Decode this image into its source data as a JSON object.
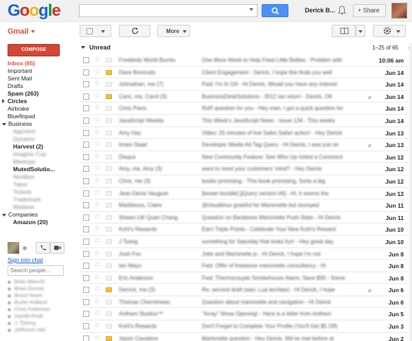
{
  "topbar": {
    "logo": [
      "G",
      "o",
      "o",
      "g",
      "l",
      "e"
    ],
    "logo_colors": [
      "#1a61d7",
      "#d62d20",
      "#f2b50f",
      "#1a61d7",
      "#009925",
      "#d62d20"
    ],
    "search_placeholder": "",
    "user_name": "Derick B...",
    "share_label": "+ Share"
  },
  "toolbar": {
    "app_label": "Gmail",
    "more_label": "More"
  },
  "nav": {
    "compose_label": "COMPOSE",
    "items": [
      {
        "label": "Inbox (65)",
        "style": "active"
      },
      {
        "label": "Important",
        "style": ""
      },
      {
        "label": "Sent Mail",
        "style": ""
      },
      {
        "label": "Drafts",
        "style": ""
      },
      {
        "label": "Spam (263)",
        "style": "bold"
      },
      {
        "label": "Circles",
        "style": "bold-collapsed"
      },
      {
        "label": "Airbrake",
        "style": ""
      },
      {
        "label": "Bluefinpad",
        "style": ""
      },
      {
        "label": "Business",
        "style": "expanded"
      },
      {
        "label": "AppVerb",
        "style": "sub-blur"
      },
      {
        "label": "Dynamo",
        "style": "sub-blur"
      },
      {
        "label": "Harvest (2)",
        "style": "sub-bold"
      },
      {
        "label": "Imagine Cup",
        "style": "sub-blur"
      },
      {
        "label": "Meetups",
        "style": "sub-blur"
      },
      {
        "label": "MutedSolutio...",
        "style": "sub-bold"
      },
      {
        "label": "Nextbox",
        "style": "sub-blur"
      },
      {
        "label": "Tabor",
        "style": "sub-blur"
      },
      {
        "label": "Tickets",
        "style": "sub-blur"
      },
      {
        "label": "Trademark",
        "style": "sub-blur"
      },
      {
        "label": "Webinar",
        "style": "sub-blur"
      },
      {
        "label": "Companies",
        "style": "expanded"
      },
      {
        "label": "Amazon (20)",
        "style": "sub-bold"
      }
    ]
  },
  "chat": {
    "sign_in": "Sign into chat",
    "search_placeholder": "Search people...",
    "contacts": [
      "Brian Bianchi",
      "Brian Dumas",
      "Bruce Nixon",
      "Burke Holland",
      "Chris Patterson",
      "Harold Rook",
      "J. Tjoeng",
      "Jefferson Vail"
    ]
  },
  "list": {
    "section_label": "Unread",
    "range": "1–25 of 65",
    "rows": [
      {
        "sender": "Freebirds World Burrito",
        "subject": "One More Week to Help Feed Little Bellies - Problem with",
        "date": "10:06 am",
        "imp": false,
        "clip": false
      },
      {
        "sender": "Dave Brenrods",
        "subject": "Client Engagement - Derick, I hope this finds you well",
        "date": "Jun 14",
        "imp": true,
        "clip": false
      },
      {
        "sender": "Johnathan, me (7)",
        "subject": "Fwd: I'm In OA - Hi Derick, Would you have any interest",
        "date": "Jun 14",
        "imp": false,
        "clip": false
      },
      {
        "sender": "Canc, me, Carol (3)",
        "subject": "BusinessDeskSolutions - 2012 tax return - Derick, OK",
        "date": "Jun 14",
        "imp": true,
        "clip": true
      },
      {
        "sender": "Chris Pavis",
        "subject": "RoR question for you - Hey man, I got a quick question for",
        "date": "Jun 14",
        "imp": false,
        "clip": false
      },
      {
        "sender": "JavaScript Weekly",
        "subject": "This Week's JavaScript News - Issue 134 - This weeks",
        "date": "Jun 14",
        "imp": false,
        "clip": false
      },
      {
        "sender": "Amy Hay",
        "subject": "Video: 25 minutes of live Sales Safari action! - Hey Derick",
        "date": "Jun 13",
        "imp": false,
        "clip": false
      },
      {
        "sender": "Imam Saad",
        "subject": "Developer Media Ad Tag Query - Hi Derick, I was just on",
        "date": "Jun 13",
        "imp": false,
        "clip": true
      },
      {
        "sender": "Disqus",
        "subject": "New Community Feature: See Who Up-Voted a Comment",
        "date": "Jun 12",
        "imp": false,
        "clip": false
      },
      {
        "sender": "Amy, me, Amy (3)",
        "subject": "want to reset your customers' mind? - Hey Derick",
        "date": "Jun 12",
        "imp": false,
        "clip": false
      },
      {
        "sender": "Chris, me (3)",
        "subject": "books promising - This book promising, Sorts a big",
        "date": "Jun 12",
        "imp": false,
        "clip": false
      },
      {
        "sender": "Jean-Denis Vauguet",
        "subject": "[bower-bundle] [jQuery version #6] - Hi, it seems the",
        "date": "Jun 12",
        "imp": false,
        "clip": false
      },
      {
        "sender": "Marbleous, Claire",
        "subject": "@cloudlinux grateful for Marionette but stumped",
        "date": "Jun 11",
        "imp": false,
        "clip": false
      },
      {
        "sender": "Shawn LW Quan Chang",
        "subject": "Question on Backbone Marionette Push State - Hi Derick",
        "date": "Jun 11",
        "imp": false,
        "clip": false
      },
      {
        "sender": "Kohl's Rewards",
        "subject": "Earn Triple Points - Celebrate Your New Kohl's Reward",
        "date": "Jun 10",
        "imp": false,
        "clip": false
      },
      {
        "sender": "J Tsang",
        "subject": "something for Saturday that looks fun! - Hey great day",
        "date": "Jun 10",
        "imp": false,
        "clip": false
      },
      {
        "sender": "Josh Fox",
        "subject": "Jobs and Marionette.js - Hi Derick, I hope I'm not",
        "date": "Jun 8",
        "imp": false,
        "clip": false
      },
      {
        "sender": "Ian Mayo",
        "subject": "Fwd: Offer of freelance marionette consultancy - Hi",
        "date": "Jun 8",
        "imp": false,
        "clip": false
      },
      {
        "sender": "Eric Anderson",
        "subject": "Fwd: Thermocouple Smokehouse Alarm, Save $30 - Some",
        "date": "Jun 8",
        "imp": false,
        "clip": false
      },
      {
        "sender": "Derrick, me (3)",
        "subject": "Re: second draft (was: Lua techlaw) - Hi Derick, I hope",
        "date": "Jun 6",
        "imp": true,
        "clip": true
      },
      {
        "sender": "Thomas Chermineau",
        "subject": "Question about marionette and navigation - Hi Derick",
        "date": "Jun 6",
        "imp": false,
        "clip": false
      },
      {
        "sender": "Anthem Studios™",
        "subject": "\"Array\" Show Opening! - Here is a letter from Anthem",
        "date": "Jun 5",
        "imp": false,
        "clip": false
      },
      {
        "sender": "Kohl's Rewards",
        "subject": "Don't Forget to Complete Your Profile (You'll Get $5 Off)",
        "date": "Jun 3",
        "imp": false,
        "clip": false
      },
      {
        "sender": "Jason Cavaliere",
        "subject": "Marionette question - Hey Derick, We've met before at",
        "date": "Jun 2",
        "imp": true,
        "clip": false
      },
      {
        "sender": "Josh, me, Josh (3)",
        "subject": "Quick screencasting question - Hey Derick, I'm working",
        "date": "Jun 1",
        "imp": false,
        "clip": false
      }
    ]
  }
}
